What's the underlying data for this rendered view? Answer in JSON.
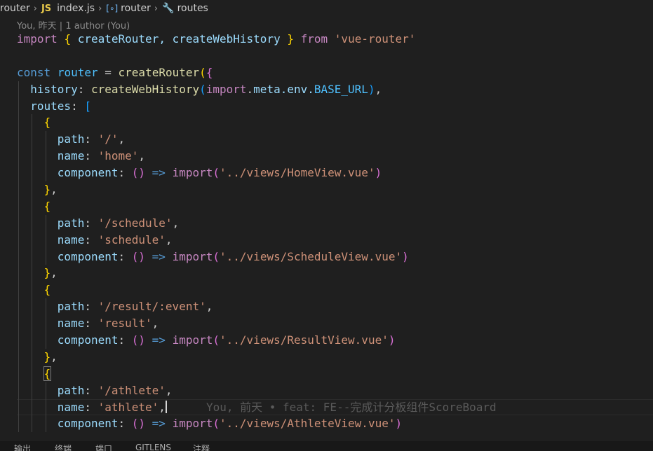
{
  "breadcrumb": {
    "folder": "router",
    "js_badge": "JS",
    "file": "index.js",
    "symbol_icon": "[∘]",
    "symbol": "router",
    "routes_icon": "🔧",
    "routes": "routes",
    "separator": "›"
  },
  "codelens": "You, 昨天 | 1 author (You)",
  "code": {
    "import_kw": "import",
    "import_names": "createRouter, createWebHistory",
    "createRouter": "createRouter",
    "createWebHistory": "createWebHistory",
    "from_kw": "from",
    "module": "'vue-router'",
    "const_kw": "const",
    "router_var": "router",
    "history_key": "history",
    "meta_chain": "meta.env.",
    "base_url": "BASE_URL",
    "routes_key": "routes",
    "path_key": "path",
    "name_key": "name",
    "component_key": "component",
    "import_fn": "import",
    "arrow": "=>",
    "routes": [
      {
        "path": "'/'",
        "name": "'home'",
        "component": "'../views/HomeView.vue'"
      },
      {
        "path": "'/schedule'",
        "name": "'schedule'",
        "component": "'../views/ScheduleView.vue'"
      },
      {
        "path": "'/result/:event'",
        "name": "'result'",
        "component": "'../views/ResultView.vue'"
      },
      {
        "path": "'/athlete'",
        "name": "'athlete'",
        "component": "'../views/AthleteView.vue'"
      }
    ]
  },
  "blame": "You, 前天 • feat: FE--完成计分板组件ScoreBoard",
  "panel_tabs": [
    "输出",
    "终端",
    "端口",
    "GITLENS",
    "注释"
  ],
  "colors": {
    "background": "#1f1f1f",
    "keyword_control": "#c586c0",
    "keyword_storage": "#569cd6",
    "variable": "#9cdcfe",
    "constant": "#4fc1ff",
    "function": "#dcdcaa",
    "string": "#ce9178",
    "bracket_level1": "#ffd700",
    "bracket_level2": "#da70d6",
    "bracket_level3": "#179fff"
  }
}
